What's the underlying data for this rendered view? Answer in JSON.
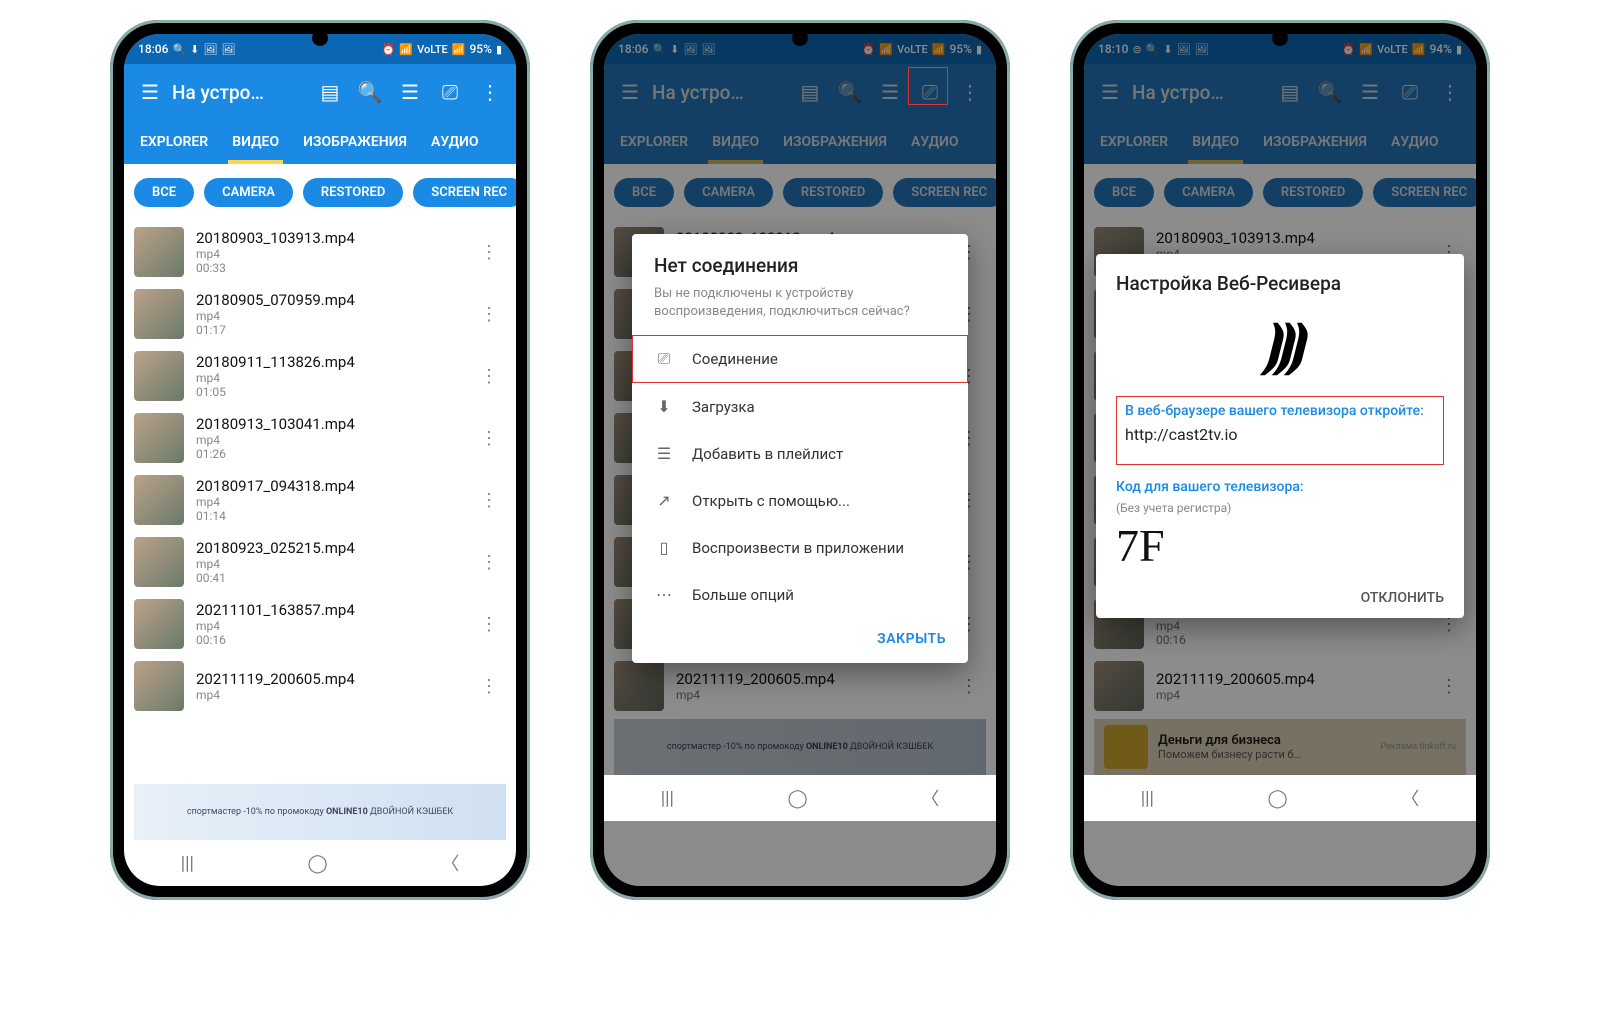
{
  "status1": {
    "time": "18:06",
    "battery": "95%",
    "net": "VoLTE"
  },
  "status3": {
    "time": "18:10",
    "battery": "94%",
    "net": "VoLTE"
  },
  "appbar": {
    "title": "На устро…"
  },
  "tabs": [
    "EXPLORER",
    "ВИДЕО",
    "ИЗОБРАЖЕНИЯ",
    "АУДИО"
  ],
  "pills": [
    "ВСЕ",
    "CAMERA",
    "RESTORED",
    "SCREEN REC"
  ],
  "files": [
    {
      "name": "20180903_103913.mp4",
      "ext": "mp4",
      "dur": "00:33"
    },
    {
      "name": "20180905_070959.mp4",
      "ext": "mp4",
      "dur": "01:17"
    },
    {
      "name": "20180911_113826.mp4",
      "ext": "mp4",
      "dur": "01:05"
    },
    {
      "name": "20180913_103041.mp4",
      "ext": "mp4",
      "dur": "01:26"
    },
    {
      "name": "20180917_094318.mp4",
      "ext": "mp4",
      "dur": "01:14"
    },
    {
      "name": "20180923_025215.mp4",
      "ext": "mp4",
      "dur": "00:41"
    },
    {
      "name": "20211101_163857.mp4",
      "ext": "mp4",
      "dur": "00:16"
    },
    {
      "name": "20211119_200605.mp4",
      "ext": "mp4",
      "dur": ""
    }
  ],
  "ad1": {
    "promo": "-10% по промокоду",
    "code": "ONLINE10",
    "brand": "спортмастер",
    "tag": "ДВОЙНОЙ КЭШБЕК"
  },
  "dialog1": {
    "title": "Нет соединения",
    "subtitle": "Вы не подключены к устройству воспроизведения, подключиться сейчас?",
    "options": [
      "Соединение",
      "Загрузка",
      "Добавить в плейлист",
      "Открыть с помощью...",
      "Воспроизвести в приложении",
      "Больше опций"
    ],
    "close": "ЗАКРЫТЬ"
  },
  "dialog2": {
    "title": "Настройка Веб-Ресивера",
    "instruction": "В веб-браузере вашего телевизора откройте:",
    "url": "http://cast2tv.io",
    "codelabel": "Код для вашего телевизора:",
    "codehint": "(Без учета регистра)",
    "code": "7F",
    "dismiss": "ОТКЛОНИТЬ"
  },
  "ad3": {
    "title": "Деньги для бизнеса",
    "sub": "Поможем бизнесу расти б…",
    "attr": "Реклама tinkoff.ru"
  }
}
